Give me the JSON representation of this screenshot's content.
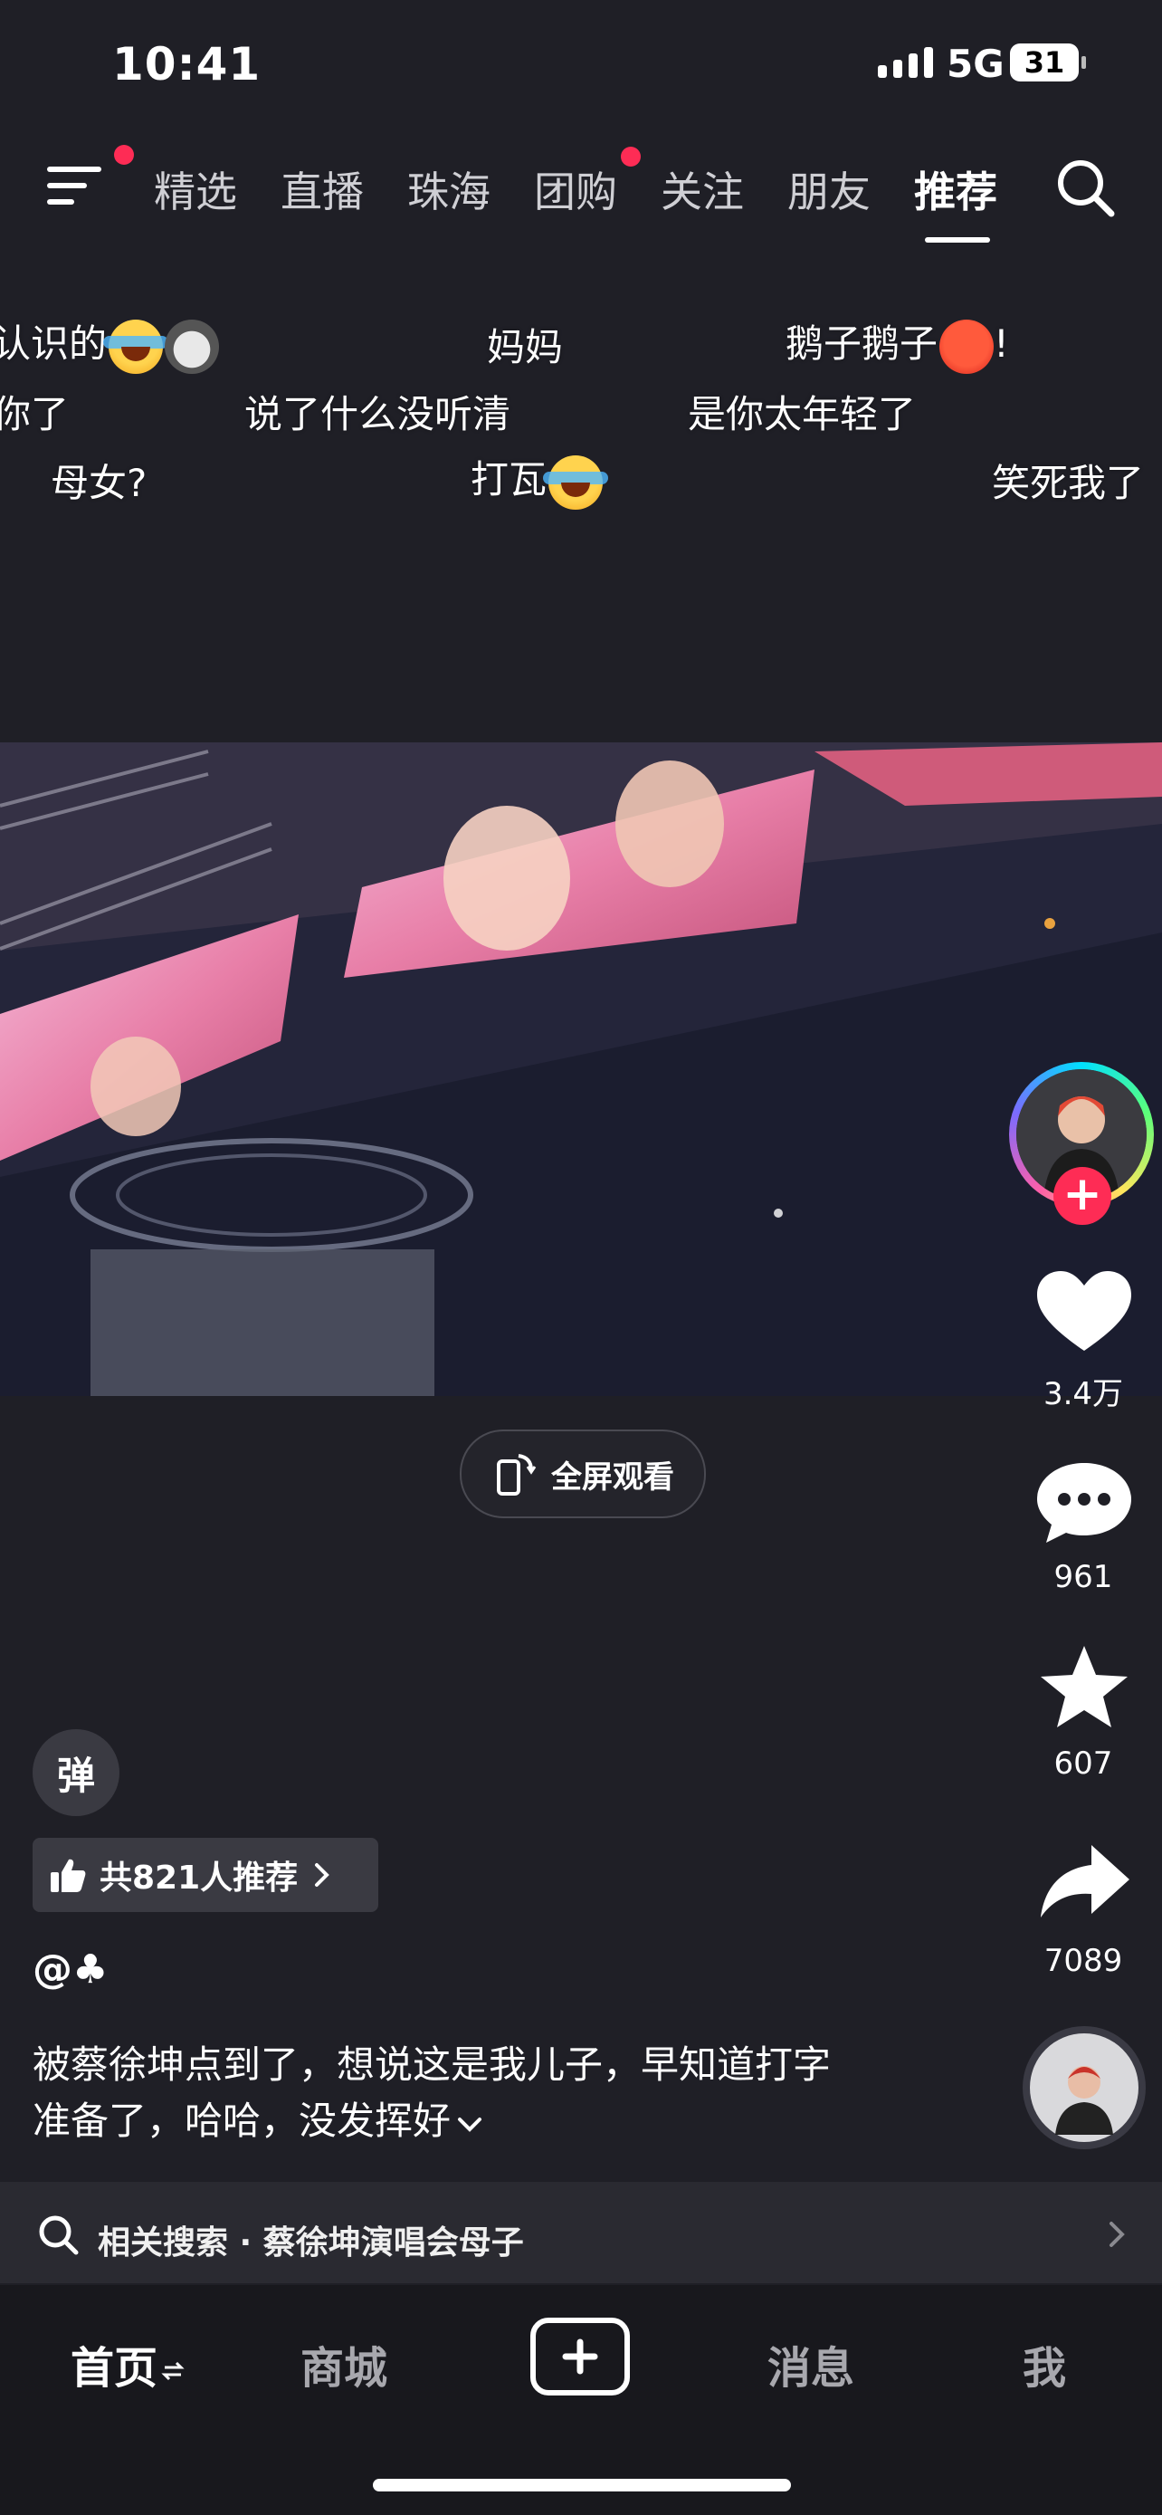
{
  "status_bar": {
    "time": "10:41",
    "network": "5G",
    "battery": "31"
  },
  "top_nav": {
    "tabs": [
      {
        "label": "精选",
        "badge": false
      },
      {
        "label": "直播",
        "badge": false
      },
      {
        "label": "珠海",
        "badge": false
      },
      {
        "label": "团购",
        "badge": true
      },
      {
        "label": "关注",
        "badge": false
      },
      {
        "label": "朋友",
        "badge": false
      },
      {
        "label": "推荐",
        "badge": false,
        "active": true
      }
    ],
    "menu_badge": true
  },
  "danmaku": [
    {
      "text": "认识的",
      "emojis": [
        "laugh",
        "cat"
      ]
    },
    {
      "text": "妈妈",
      "emojis": []
    },
    {
      "text": "鹅子鹅子",
      "emojis": [
        "angry"
      ],
      "suffix": "!"
    },
    {
      "text": "你了",
      "emojis": []
    },
    {
      "text": "说了什么没听清",
      "emojis": []
    },
    {
      "text": "是你太年轻了",
      "emojis": []
    },
    {
      "text": "母女?",
      "emojis": []
    },
    {
      "text": "打瓦",
      "emojis": [
        "laugh"
      ]
    },
    {
      "text": "笑死我了",
      "emojis": []
    }
  ],
  "video": {
    "fullscreen_label": "全屏观看"
  },
  "actions": {
    "likes": "3.4万",
    "comments": "961",
    "favorites": "607",
    "shares": "7089"
  },
  "info": {
    "danmaku_toggle": "弹",
    "recommend": "共821人推荐",
    "author": "@♣",
    "caption_line1": "被蔡徐坤点到了，想说这是我儿子，早知道打字",
    "caption_line2": "准备了，哈哈，没发挥好",
    "related_search": "相关搜索 · 蔡徐坤演唱会母子"
  },
  "tab_bar": {
    "home": "首页",
    "mall": "商城",
    "messages": "消息",
    "me": "我"
  },
  "colors": {
    "accent": "#fe2c55",
    "background": "#1f1f26"
  }
}
